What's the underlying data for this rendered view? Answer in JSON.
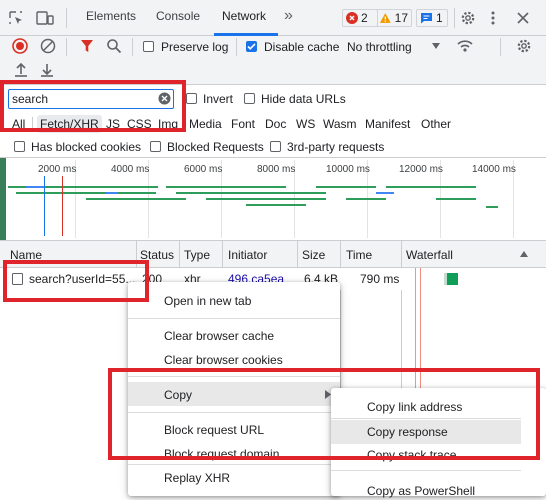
{
  "toolbar_top": {
    "tabs": [
      {
        "label": "Elements"
      },
      {
        "label": "Console"
      },
      {
        "label": "Network"
      }
    ],
    "more_tabs_glyph": "»",
    "errors_count": "2",
    "warnings_count": "17",
    "info_count": "1"
  },
  "network_toolbar": {
    "preserve_log_label": "Preserve log",
    "disable_cache_label": "Disable cache",
    "throttling_value": "No throttling"
  },
  "filter": {
    "input_value": "search",
    "invert_label": "Invert",
    "hide_data_urls_label": "Hide data URLs",
    "types": [
      "All",
      "Fetch/XHR",
      "JS",
      "CSS",
      "Img",
      "Media",
      "Font",
      "Doc",
      "WS",
      "Wasm",
      "Manifest",
      "Other"
    ],
    "active_type": "Fetch/XHR",
    "has_blocked_cookies_label": "Has blocked cookies",
    "blocked_requests_label": "Blocked Requests",
    "third_party_label": "3rd-party requests"
  },
  "overview": {
    "ticks": [
      "2000 ms",
      "4000 ms",
      "6000 ms",
      "8000 ms",
      "10000 ms",
      "12000 ms",
      "14000 ms"
    ]
  },
  "table": {
    "columns": [
      "Name",
      "Status",
      "Type",
      "Initiator",
      "Size",
      "Time",
      "Waterfall"
    ],
    "rows": [
      {
        "name": "search?userId=55...",
        "status": "200",
        "type": "xhr",
        "initiator": "496.ca5ea",
        "size": "6.4 kB",
        "time": "790 ms"
      }
    ]
  },
  "context_menu": {
    "items": [
      "Open in new tab",
      "Clear browser cache",
      "Clear browser cookies",
      "Copy",
      "Block request URL",
      "Block request domain",
      "Replay XHR"
    ]
  },
  "copy_submenu": {
    "items": [
      "Copy link address",
      "Copy response",
      "Copy stack trace",
      "Copy as PowerShell"
    ]
  },
  "colors": {
    "accent_blue": "#1a73e8",
    "highlight_red": "#e0242b",
    "record_red": "#d93025",
    "error_red": "#d93025",
    "warning_orange": "#f29900",
    "waterfall_green": "#0f9d58"
  }
}
